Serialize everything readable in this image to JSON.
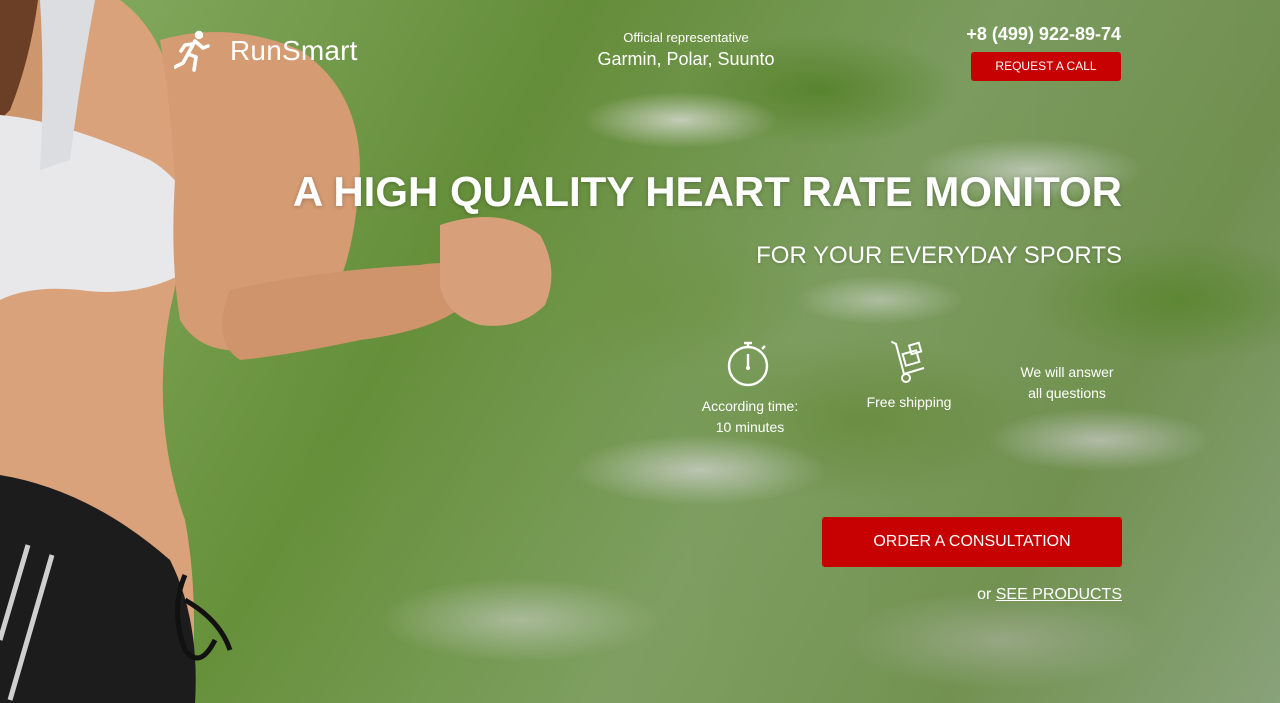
{
  "brand": {
    "name": "RunSmart",
    "logo_icon": "runner-icon"
  },
  "header": {
    "rep_label": "Official representative",
    "rep_brands": "Garmin, Polar, Suunto",
    "phone": "+8 (499) 922-89-74",
    "call_button": "REQUEST A CALL"
  },
  "hero": {
    "title": "A HIGH QUALITY HEART RATE MONITOR",
    "subtitle": "FOR YOUR EVERYDAY SPORTS"
  },
  "features": [
    {
      "icon": "stopwatch-icon",
      "line1": "According time:",
      "line2": "10 minutes"
    },
    {
      "icon": "hand-truck-icon",
      "line1": "Free shipping",
      "line2": ""
    },
    {
      "icon": "",
      "line1": "We will answer",
      "line2": "all questions"
    }
  ],
  "cta": {
    "order_button": "ORDER A CONSULTATION",
    "or_text": "or",
    "products_link": "SEE PRODUCTS"
  },
  "colors": {
    "accent": "#c70101",
    "text": "#ffffff"
  }
}
